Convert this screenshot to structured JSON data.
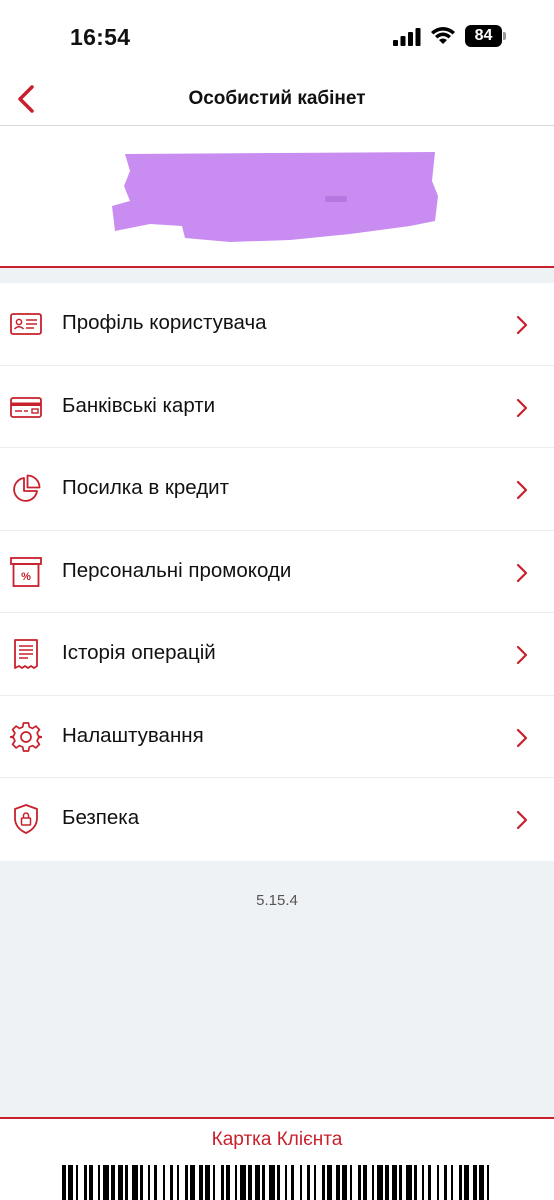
{
  "status_bar": {
    "time": "16:54",
    "battery": "84"
  },
  "header": {
    "title": "Особистий кабінет",
    "back_icon": "chevron-left-icon"
  },
  "profile": {
    "name_redacted": true,
    "redaction_color": "#c98cf0"
  },
  "menu": {
    "items": [
      {
        "label": "Профіль користувача",
        "icon": "id-card-icon"
      },
      {
        "label": "Банківські карти",
        "icon": "bank-card-icon"
      },
      {
        "label": "Посилка в кредит",
        "icon": "pie-chart-icon"
      },
      {
        "label": "Персональні промокоди",
        "icon": "promo-box-icon"
      },
      {
        "label": "Історія операцій",
        "icon": "receipt-icon"
      },
      {
        "label": "Налаштування",
        "icon": "gear-icon"
      },
      {
        "label": "Безпека",
        "icon": "shield-lock-icon"
      }
    ]
  },
  "version": "5.15.4",
  "footer": {
    "title": "Картка Клієнта"
  },
  "colors": {
    "accent": "#c8202c",
    "background": "#eff2f5"
  }
}
